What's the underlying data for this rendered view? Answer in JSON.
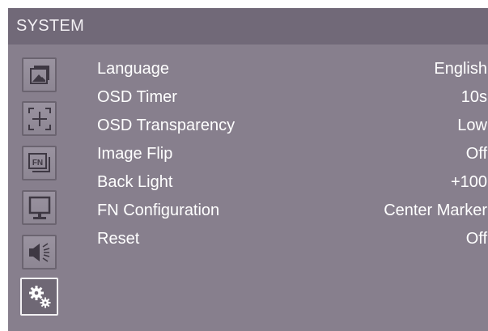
{
  "header": {
    "title": "SYSTEM"
  },
  "sidebar": {
    "items": [
      {
        "name": "picture-icon",
        "selected": false
      },
      {
        "name": "marker-icon",
        "selected": false
      },
      {
        "name": "fn-icon",
        "selected": false
      },
      {
        "name": "display-icon",
        "selected": false
      },
      {
        "name": "audio-icon",
        "selected": false
      },
      {
        "name": "system-gears-icon",
        "selected": true
      }
    ]
  },
  "menu": {
    "rows": [
      {
        "label": "Language",
        "value": "English"
      },
      {
        "label": "OSD Timer",
        "value": "10s"
      },
      {
        "label": "OSD Transparency",
        "value": "Low"
      },
      {
        "label": "Image Flip",
        "value": "Off"
      },
      {
        "label": "Back Light",
        "value": "+100"
      },
      {
        "label": "FN Configuration",
        "value": "Center Marker"
      },
      {
        "label": "Reset",
        "value": "Off"
      }
    ]
  },
  "colors": {
    "background": "#877f8d",
    "title_bar": "#716978",
    "text": "#ffffff"
  }
}
